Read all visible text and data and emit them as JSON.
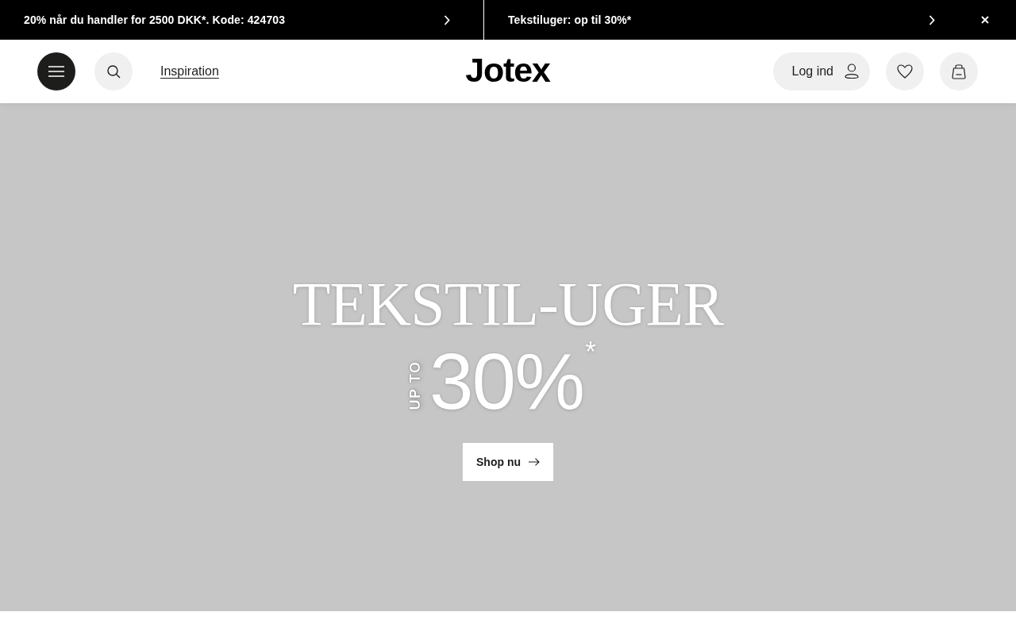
{
  "announcements": [
    {
      "text": "20% når du handler for 2500 DKK*. Kode: 424703"
    },
    {
      "text": "Tekstiluger: op til 30%*"
    }
  ],
  "header": {
    "nav_link": "Inspiration",
    "logo": "Jotex",
    "login": "Log ind"
  },
  "hero": {
    "title": "TEKSTIL-UGER",
    "prefix": "UP TO",
    "discount": "30%$^{*}$",
    "button": "Shop nu"
  }
}
